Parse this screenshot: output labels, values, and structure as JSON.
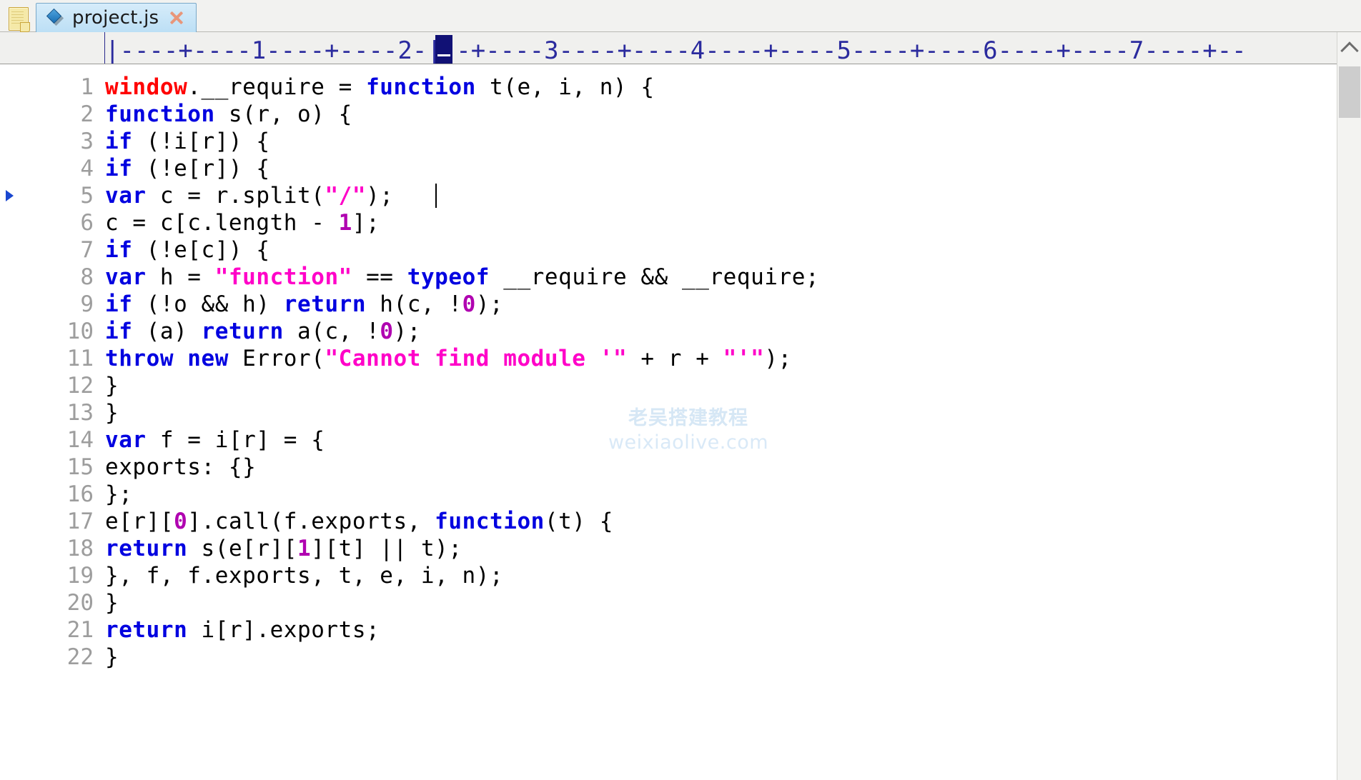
{
  "window": {
    "doc_icon": "folder-document-icon"
  },
  "tabbar": {
    "tabs": [
      {
        "label": "project.js",
        "icon": "js-diamond-icon",
        "close_icon": "close-x-icon",
        "active": true
      }
    ]
  },
  "ruler": {
    "scale": "|----+----1----+----2-|--+----3----+----4----+----5----+----6----+----7----+--",
    "cursor_column": 22,
    "marks": [
      "1",
      "2",
      "3",
      "4",
      "5",
      "6",
      "7"
    ]
  },
  "editor": {
    "caret": {
      "line": 5,
      "column": 22
    },
    "fold_marker_line": 5,
    "line_count_visible": 22,
    "lines": [
      {
        "n": "1",
        "tokens": [
          {
            "t": "window",
            "c": "obj"
          },
          {
            "t": ".__require = ",
            "c": "pl"
          },
          {
            "t": "function",
            "c": "kw"
          },
          {
            "t": " t(e, i, n) {",
            "c": "pl"
          }
        ]
      },
      {
        "n": "2",
        "tokens": [
          {
            "t": "function",
            "c": "kw"
          },
          {
            "t": " s(r, o) {",
            "c": "pl"
          }
        ]
      },
      {
        "n": "3",
        "tokens": [
          {
            "t": "if",
            "c": "kw"
          },
          {
            "t": " (!i[r]) {",
            "c": "pl"
          }
        ]
      },
      {
        "n": "4",
        "tokens": [
          {
            "t": "if",
            "c": "kw"
          },
          {
            "t": " (!e[r]) {",
            "c": "pl"
          }
        ]
      },
      {
        "n": "5",
        "tokens": [
          {
            "t": "var",
            "c": "kw"
          },
          {
            "t": " c = r.split(",
            "c": "pl"
          },
          {
            "t": "\"/\"",
            "c": "str"
          },
          {
            "t": ");",
            "c": "pl"
          }
        ]
      },
      {
        "n": "6",
        "tokens": [
          {
            "t": "c = c[c.length - ",
            "c": "pl"
          },
          {
            "t": "1",
            "c": "num"
          },
          {
            "t": "];",
            "c": "pl"
          }
        ]
      },
      {
        "n": "7",
        "tokens": [
          {
            "t": "if",
            "c": "kw"
          },
          {
            "t": " (!e[c]) {",
            "c": "pl"
          }
        ]
      },
      {
        "n": "8",
        "tokens": [
          {
            "t": "var",
            "c": "kw"
          },
          {
            "t": " h = ",
            "c": "pl"
          },
          {
            "t": "\"function\"",
            "c": "str"
          },
          {
            "t": " == ",
            "c": "pl"
          },
          {
            "t": "typeof",
            "c": "kw"
          },
          {
            "t": " __require && __require;",
            "c": "pl"
          }
        ]
      },
      {
        "n": "9",
        "tokens": [
          {
            "t": "if",
            "c": "kw"
          },
          {
            "t": " (!o && h) ",
            "c": "pl"
          },
          {
            "t": "return",
            "c": "kw"
          },
          {
            "t": " h(c, !",
            "c": "pl"
          },
          {
            "t": "0",
            "c": "num"
          },
          {
            "t": ");",
            "c": "pl"
          }
        ]
      },
      {
        "n": "10",
        "tokens": [
          {
            "t": "if",
            "c": "kw"
          },
          {
            "t": " (a) ",
            "c": "pl"
          },
          {
            "t": "return",
            "c": "kw"
          },
          {
            "t": " a(c, !",
            "c": "pl"
          },
          {
            "t": "0",
            "c": "num"
          },
          {
            "t": ");",
            "c": "pl"
          }
        ]
      },
      {
        "n": "11",
        "tokens": [
          {
            "t": "throw",
            "c": "kw"
          },
          {
            "t": " ",
            "c": "pl"
          },
          {
            "t": "new",
            "c": "kw"
          },
          {
            "t": " Error(",
            "c": "pl"
          },
          {
            "t": "\"Cannot find module '\"",
            "c": "str"
          },
          {
            "t": " + r + ",
            "c": "pl"
          },
          {
            "t": "\"'\"",
            "c": "str"
          },
          {
            "t": ");",
            "c": "pl"
          }
        ]
      },
      {
        "n": "12",
        "tokens": [
          {
            "t": "}",
            "c": "pl"
          }
        ]
      },
      {
        "n": "13",
        "tokens": [
          {
            "t": "}",
            "c": "pl"
          }
        ]
      },
      {
        "n": "14",
        "tokens": [
          {
            "t": "var",
            "c": "kw"
          },
          {
            "t": " f = i[r] = {",
            "c": "pl"
          }
        ]
      },
      {
        "n": "15",
        "tokens": [
          {
            "t": "exports: {}",
            "c": "pl"
          }
        ]
      },
      {
        "n": "16",
        "tokens": [
          {
            "t": "};",
            "c": "pl"
          }
        ]
      },
      {
        "n": "17",
        "tokens": [
          {
            "t": "e[r][",
            "c": "pl"
          },
          {
            "t": "0",
            "c": "num"
          },
          {
            "t": "].call(f.exports, ",
            "c": "pl"
          },
          {
            "t": "function",
            "c": "kw"
          },
          {
            "t": "(t) {",
            "c": "pl"
          }
        ]
      },
      {
        "n": "18",
        "tokens": [
          {
            "t": "return",
            "c": "kw"
          },
          {
            "t": " s(e[r][",
            "c": "pl"
          },
          {
            "t": "1",
            "c": "num"
          },
          {
            "t": "][t] || t);",
            "c": "pl"
          }
        ]
      },
      {
        "n": "19",
        "tokens": [
          {
            "t": "}, f, f.exports, t, e, i, n);",
            "c": "pl"
          }
        ]
      },
      {
        "n": "20",
        "tokens": [
          {
            "t": "}",
            "c": "pl"
          }
        ]
      },
      {
        "n": "21",
        "tokens": [
          {
            "t": "return",
            "c": "kw"
          },
          {
            "t": " i[r].exports;",
            "c": "pl"
          }
        ]
      },
      {
        "n": "22",
        "tokens": [
          {
            "t": "}",
            "c": "pl"
          }
        ]
      }
    ]
  },
  "watermark": {
    "line1": "老吴搭建教程",
    "line2": "weixiaolive.com"
  },
  "scrollbar": {
    "up_arrow_icon": "chevron-up-icon",
    "thumb": "scroll-thumb"
  },
  "colors": {
    "keyword": "#0000e0",
    "string": "#ff00c8",
    "number": "#b000b0",
    "object": "#ff0000",
    "plain": "#000000",
    "lineno": "#9d9d9d",
    "ruler": "#2b2b9e",
    "tab_active": "#c5e3f6",
    "watermark": "#d6e7f5"
  }
}
